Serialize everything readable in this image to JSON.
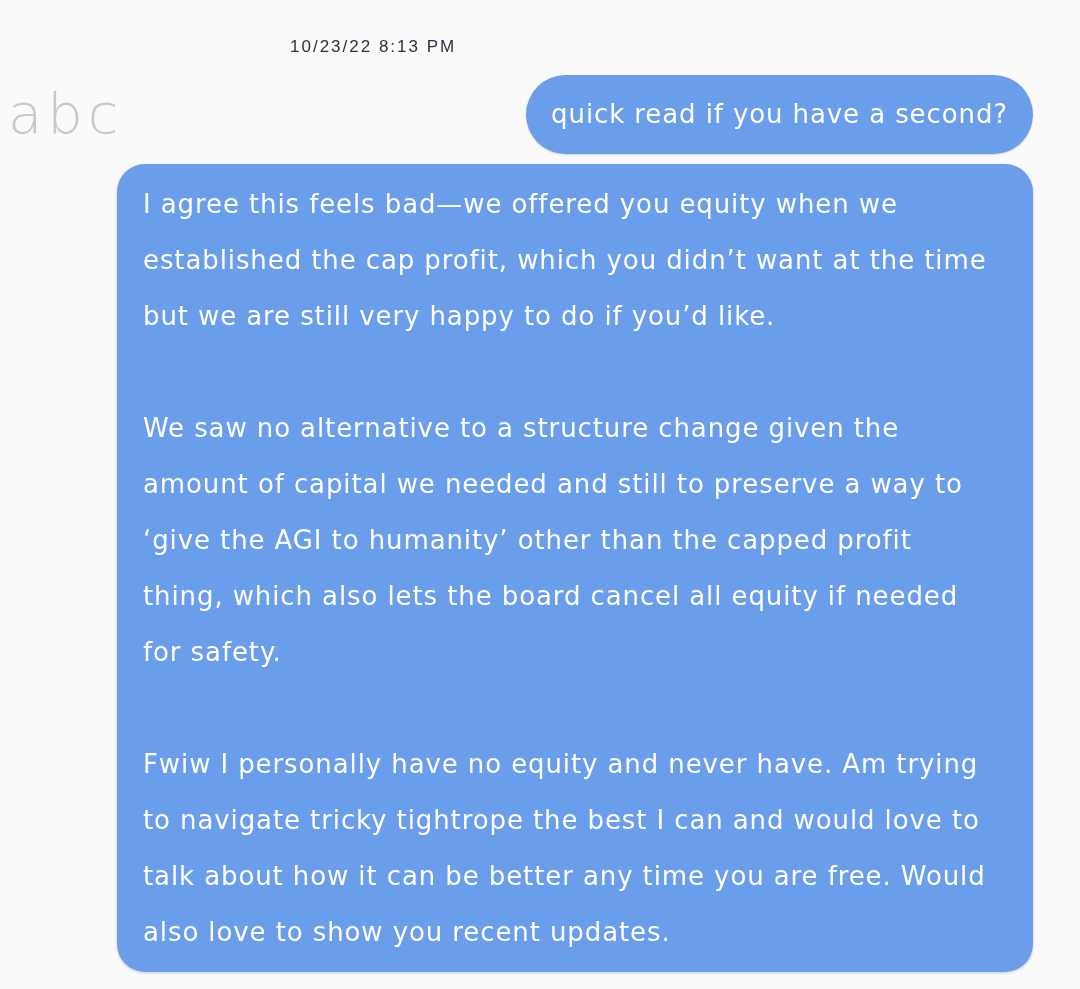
{
  "timestamp": "10/23/22 8:13 PM",
  "sender_label": "abc",
  "messages": [
    {
      "kind": "short",
      "paragraphs": [
        "quick read if you have a second?"
      ]
    },
    {
      "kind": "long",
      "paragraphs": [
        "I agree this feels bad—we offered you equity when we\nestablished the cap profit, which you didn’t want at the time\nbut we are still very happy to do if you’d like.",
        "We saw no alternative to a structure change given the\namount of capital we needed and still to preserve a way to\n‘give the AGI to humanity’ other than the capped profit\nthing, which also lets the board cancel all equity if needed\nfor safety.",
        "Fwiw I personally have no equity and never have. Am trying\nto navigate tricky tightrope the best I can and would love to\ntalk about how it can be better any time you are free. Would\nalso love to show you recent updates."
      ]
    }
  ]
}
